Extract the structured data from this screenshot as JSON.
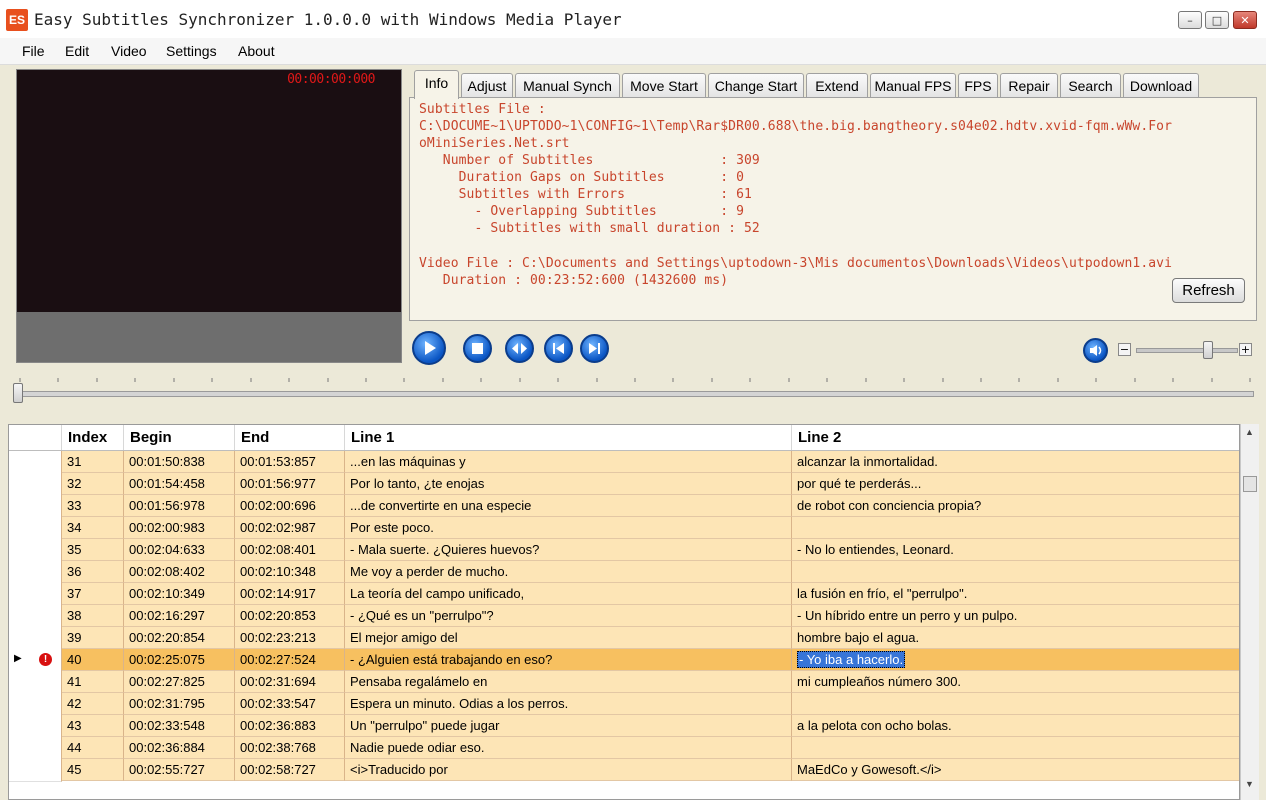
{
  "window": {
    "title": "Easy Subtitles Synchronizer 1.0.0.0 with Windows Media Player",
    "icon_text": "ES",
    "minimize_label": "–",
    "maximize_label": "□",
    "close_label": "✕"
  },
  "menu": [
    "File",
    "Edit",
    "Video",
    "Settings",
    "About"
  ],
  "player": {
    "timecode": "00:00:00:000",
    "volume_level": 0.72
  },
  "tabs": [
    "Info",
    "Adjust",
    "Manual Synch",
    "Move Start",
    "Change Start",
    "Extend",
    "Manual FPS",
    "FPS",
    "Repair",
    "Search",
    "Download"
  ],
  "active_tab": "Info",
  "info": {
    "lines": [
      "Subtitles File :",
      "C:\\DOCUME~1\\UPTODO~1\\CONFIG~1\\Temp\\Rar$DR00.688\\the.big.bangtheory.s04e02.hdtv.xvid-fqm.wWw.For",
      "oMiniSeries.Net.srt",
      "   Number of Subtitles                : 309",
      "     Duration Gaps on Subtitles       : 0",
      "     Subtitles with Errors            : 61",
      "       - Overlapping Subtitles        : 9",
      "       - Subtitles with small duration : 52",
      "",
      "Video File : C:\\Documents and Settings\\uptodown-3\\Mis documentos\\Downloads\\Videos\\utpodown1.avi",
      "   Duration : 00:23:52:600 (1432600 ms)"
    ],
    "refresh_label": "Refresh"
  },
  "grid": {
    "columns": [
      "Index",
      "Begin",
      "End",
      "Line 1",
      "Line 2"
    ],
    "rows": [
      {
        "index": "31",
        "begin": "00:01:50:838",
        "end": "00:01:53:857",
        "line1": "...en las máquinas y",
        "line2": "alcanzar la inmortalidad."
      },
      {
        "index": "32",
        "begin": "00:01:54:458",
        "end": "00:01:56:977",
        "line1": "Por lo tanto, ¿te enojas",
        "line2": "por qué te perderás..."
      },
      {
        "index": "33",
        "begin": "00:01:56:978",
        "end": "00:02:00:696",
        "line1": "...de convertirte en una especie",
        "line2": "de robot con conciencia propia?"
      },
      {
        "index": "34",
        "begin": "00:02:00:983",
        "end": "00:02:02:987",
        "line1": "Por este poco.",
        "line2": ""
      },
      {
        "index": "35",
        "begin": "00:02:04:633",
        "end": "00:02:08:401",
        "line1": "- Mala suerte. ¿Quieres huevos?",
        "line2": "- No lo entiendes, Leonard."
      },
      {
        "index": "36",
        "begin": "00:02:08:402",
        "end": "00:02:10:348",
        "line1": "Me voy a perder de mucho.",
        "line2": ""
      },
      {
        "index": "37",
        "begin": "00:02:10:349",
        "end": "00:02:14:917",
        "line1": "La teoría del campo unificado,",
        "line2": "la fusión en frío, el \"perrulpo\"."
      },
      {
        "index": "38",
        "begin": "00:02:16:297",
        "end": "00:02:20:853",
        "line1": "- ¿Qué es un \"perrulpo\"?",
        "line2": "- Un híbrido entre un perro y un pulpo."
      },
      {
        "index": "39",
        "begin": "00:02:20:854",
        "end": "00:02:23:213",
        "line1": "El mejor amigo del",
        "line2": "hombre bajo el agua."
      },
      {
        "index": "40",
        "begin": "00:02:25:075",
        "end": "00:02:27:524",
        "line1": "- ¿Alguien está trabajando en eso?",
        "line2": "- Yo iba a hacerlo.",
        "current": true,
        "error": true
      },
      {
        "index": "41",
        "begin": "00:02:27:825",
        "end": "00:02:31:694",
        "line1": "Pensaba regalámelo en",
        "line2": "mi cumpleaños número 300."
      },
      {
        "index": "42",
        "begin": "00:02:31:795",
        "end": "00:02:33:547",
        "line1": "Espera un minuto. Odias a los perros.",
        "line2": ""
      },
      {
        "index": "43",
        "begin": "00:02:33:548",
        "end": "00:02:36:883",
        "line1": "Un \"perrulpo\" puede jugar",
        "line2": "a la pelota con ocho bolas."
      },
      {
        "index": "44",
        "begin": "00:02:36:884",
        "end": "00:02:38:768",
        "line1": "Nadie puede odiar eso.",
        "line2": ""
      },
      {
        "index": "45",
        "begin": "00:02:55:727",
        "end": "00:02:58:727",
        "line1": "<i>Traducido por",
        "line2": "MaEdCo y Gowesoft.</i>"
      }
    ]
  },
  "colors": {
    "info_text": "#c8452c",
    "row_bg": "#fde5b6",
    "current_row_bg": "#f7c060",
    "timecode": "#e01818"
  }
}
